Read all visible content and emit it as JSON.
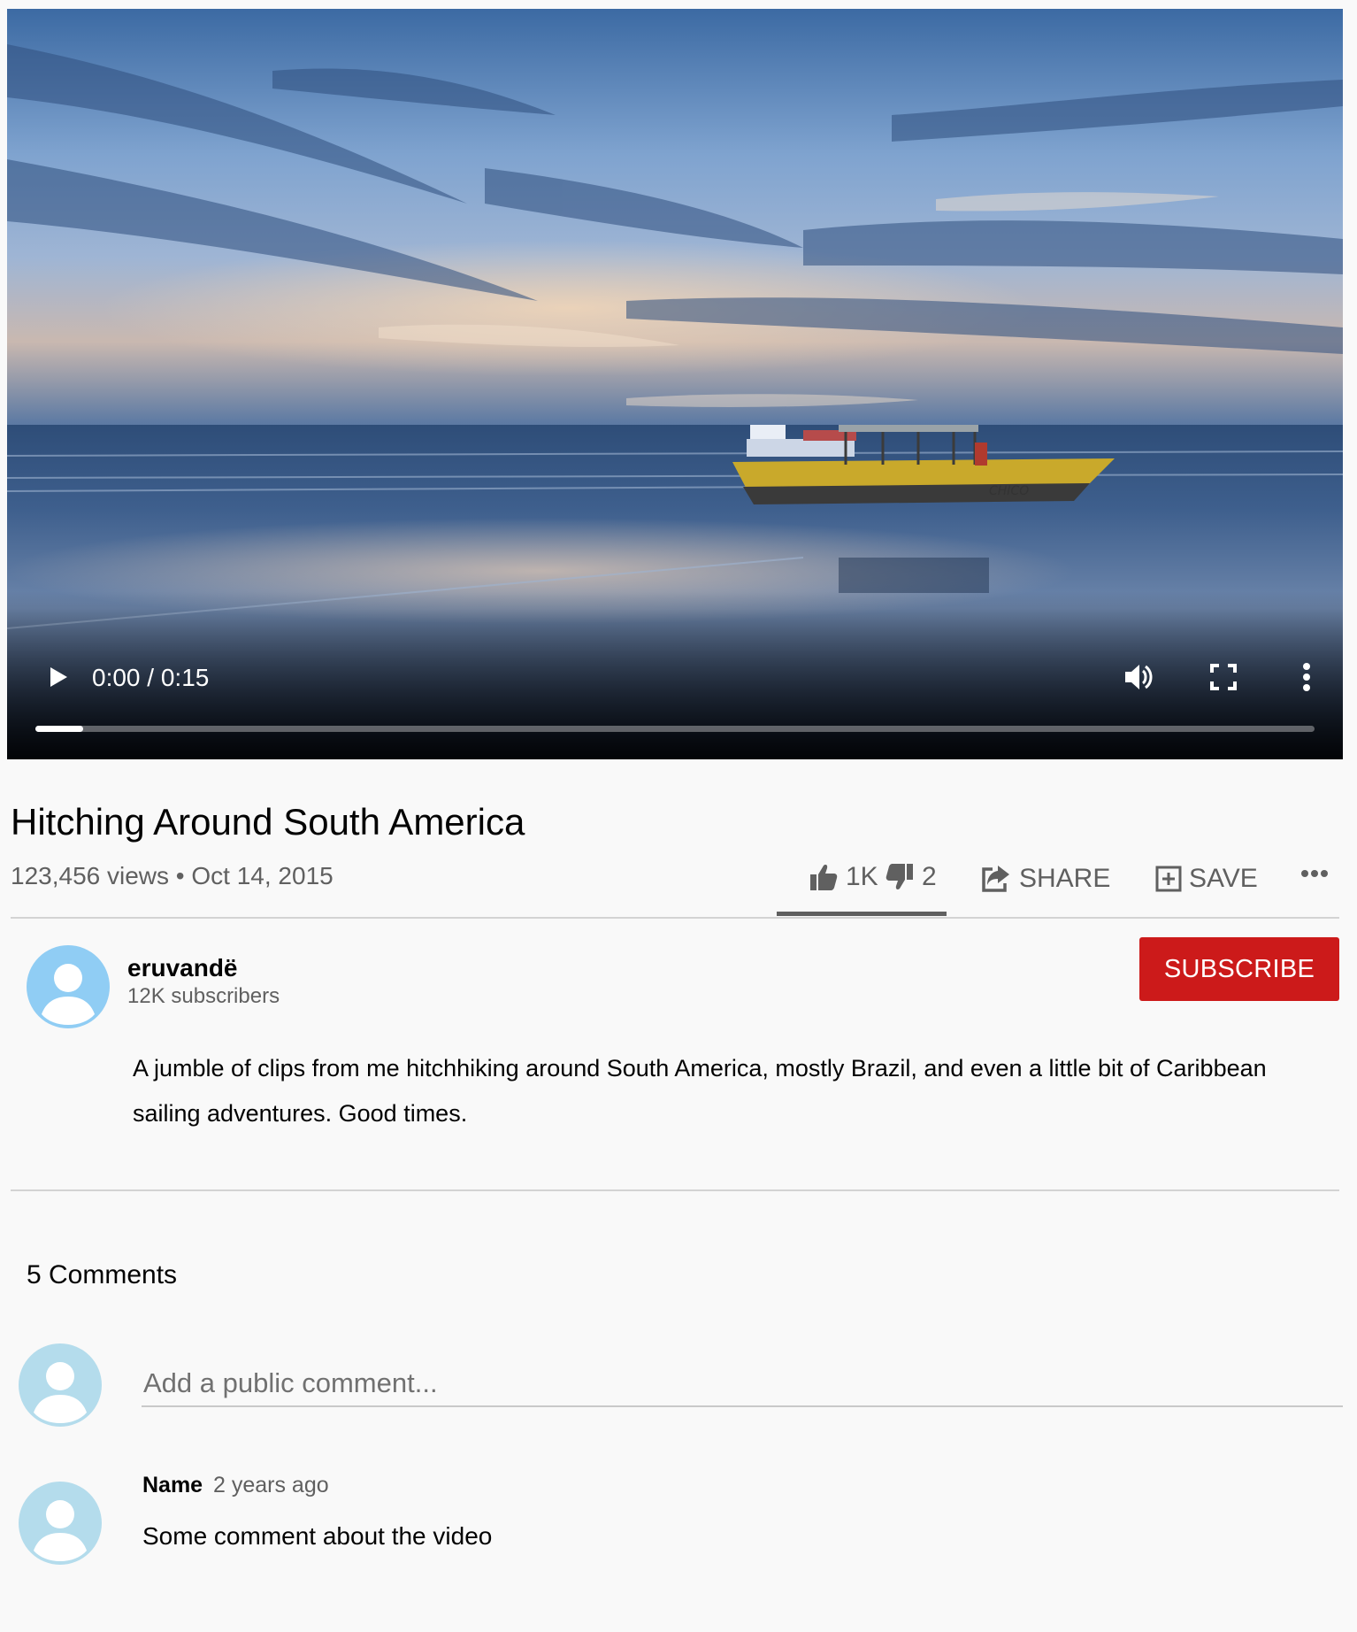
{
  "player": {
    "current_time": "0:00",
    "duration": "0:15",
    "time_separator": " / ",
    "progress_fraction": 0.037,
    "icons": [
      "play-icon",
      "volume-icon",
      "fullscreen-icon",
      "more-vert-icon"
    ]
  },
  "video": {
    "title": "Hitching Around South America",
    "views": "123,456 views",
    "meta_separator": " • ",
    "date": "Oct 14, 2015"
  },
  "actions": {
    "likes": "1K",
    "dislikes": "2",
    "share_label": "SHARE",
    "save_label": "SAVE",
    "like_fraction": 0.998
  },
  "channel": {
    "name": "eruvandë",
    "subscribers": "12K subscribers",
    "subscribe_label": "SUBSCRIBE",
    "description": "A jumble of clips from me hitchhiking around South America, mostly Brazil, and even a little bit of Caribbean sailing adventures. Good times."
  },
  "comments": {
    "count_label": "5 Comments",
    "input_placeholder": "Add a public comment...",
    "items": [
      {
        "author": "Name",
        "time": "2 years ago",
        "text": "Some comment about the video"
      }
    ]
  },
  "colors": {
    "background": "#f9f9f9",
    "subscribe_red": "#cc1a1a",
    "avatar_blue": "#90cdf4",
    "avatar_light_blue": "#b4dcec",
    "secondary_text": "#606060"
  }
}
